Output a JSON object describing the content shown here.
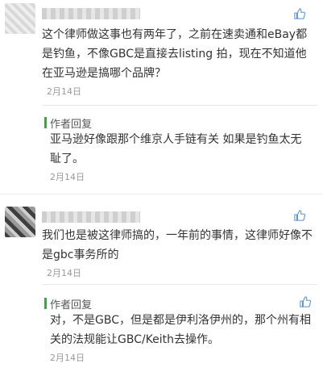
{
  "comments": [
    {
      "text": "这个律师做这事也有两年了，之前在速卖通和eBay都是钓鱼，不像GBC是直接去listing 拍，现在不知道他在亚马逊是搞哪个品牌？",
      "date": "2月14日",
      "reply": {
        "label": "作者回复",
        "text": "亚马逊好像跟那个维京人手链有关 如果是钓鱼太无耻了。",
        "date": "2月14日"
      }
    },
    {
      "text": "我们也是被这律师搞的，一年前的事情，这律师好像不是gbc事务所的",
      "date": "2月14日",
      "reply": {
        "label": "作者回复",
        "text": "对，不是GBC，但是都是伊利洛伊州的，那个州有相关的法规能让GBC/Keith去操作。",
        "date": "2月14日"
      }
    }
  ],
  "icons": {
    "like": "thumbs-up-icon"
  },
  "colors": {
    "reply_accent": "#3aa548",
    "like_icon": "#5b8fc9"
  }
}
